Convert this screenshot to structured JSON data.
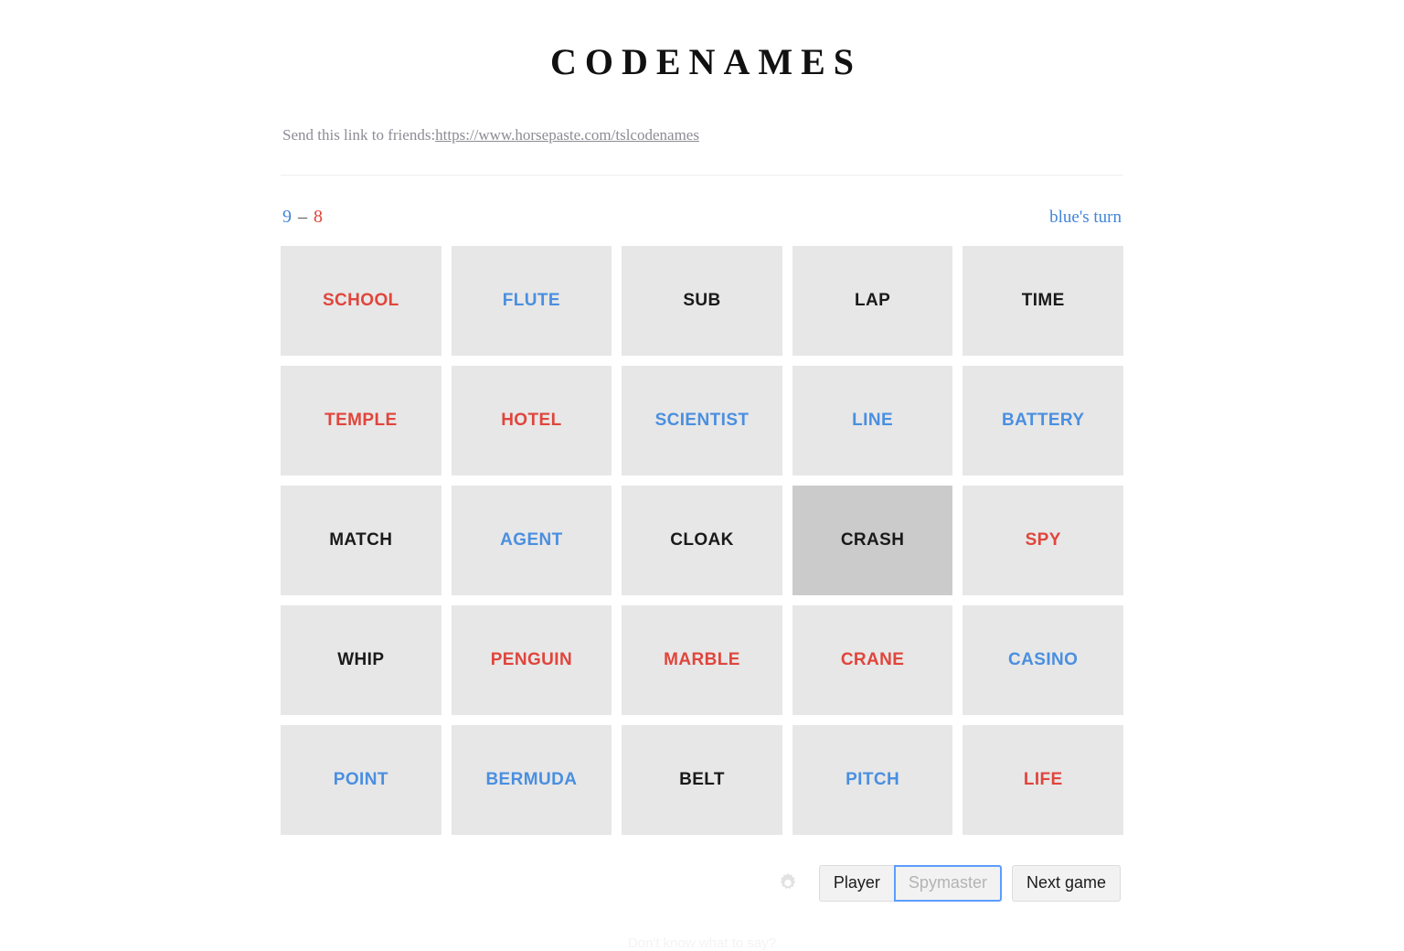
{
  "app": {
    "title": "CODENAMES"
  },
  "share": {
    "label": "Send this link to friends:",
    "url": "https://www.horsepaste.com/tslcodenames"
  },
  "status": {
    "blue_score": "9",
    "dash": "–",
    "red_score": "8",
    "turn": "blue's turn",
    "blue_color": "#4285d8",
    "red_color": "#e0453c"
  },
  "board": {
    "rows": 5,
    "cols": 5,
    "card_bg": "#e7e7e7",
    "card_bg_hovered": "#cbcbcb",
    "cards": [
      {
        "word": "SCHOOL",
        "team": "red",
        "hovered": false
      },
      {
        "word": "FLUTE",
        "team": "blue",
        "hovered": false
      },
      {
        "word": "SUB",
        "team": "neutral",
        "hovered": false
      },
      {
        "word": "LAP",
        "team": "neutral",
        "hovered": false
      },
      {
        "word": "TIME",
        "team": "neutral",
        "hovered": false
      },
      {
        "word": "TEMPLE",
        "team": "red",
        "hovered": false
      },
      {
        "word": "HOTEL",
        "team": "red",
        "hovered": false
      },
      {
        "word": "SCIENTIST",
        "team": "blue",
        "hovered": false
      },
      {
        "word": "LINE",
        "team": "blue",
        "hovered": false
      },
      {
        "word": "BATTERY",
        "team": "blue",
        "hovered": false
      },
      {
        "word": "MATCH",
        "team": "neutral",
        "hovered": false
      },
      {
        "word": "AGENT",
        "team": "blue",
        "hovered": false
      },
      {
        "word": "CLOAK",
        "team": "neutral",
        "hovered": false
      },
      {
        "word": "CRASH",
        "team": "neutral",
        "hovered": true
      },
      {
        "word": "SPY",
        "team": "red",
        "hovered": false
      },
      {
        "word": "WHIP",
        "team": "neutral",
        "hovered": false
      },
      {
        "word": "PENGUIN",
        "team": "red",
        "hovered": false
      },
      {
        "word": "MARBLE",
        "team": "red",
        "hovered": false
      },
      {
        "word": "CRANE",
        "team": "red",
        "hovered": false
      },
      {
        "word": "CASINO",
        "team": "blue",
        "hovered": false
      },
      {
        "word": "POINT",
        "team": "blue",
        "hovered": false
      },
      {
        "word": "BERMUDA",
        "team": "blue",
        "hovered": false
      },
      {
        "word": "BELT",
        "team": "neutral",
        "hovered": false
      },
      {
        "word": "PITCH",
        "team": "blue",
        "hovered": false
      },
      {
        "word": "LIFE",
        "team": "red",
        "hovered": false
      }
    ]
  },
  "controls": {
    "settings_icon": "gear-icon",
    "player_label": "Player",
    "spymaster_label": "Spymaster",
    "next_game_label": "Next game",
    "focus_color": "#5b9dff"
  },
  "footer": {
    "clipped_text": "Don't know what to say?"
  }
}
